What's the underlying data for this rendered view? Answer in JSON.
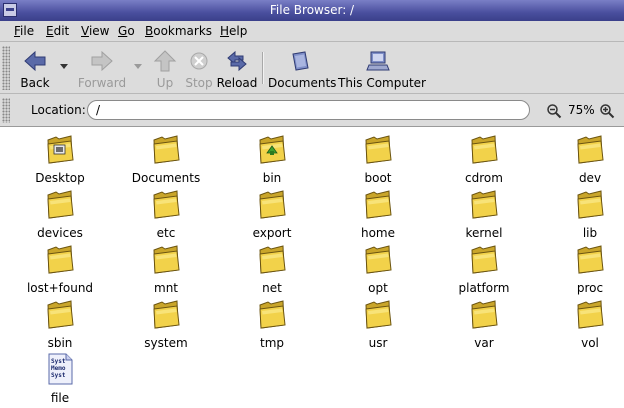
{
  "window": {
    "title": "File Browser: /"
  },
  "menubar": {
    "items": [
      "File",
      "Edit",
      "View",
      "Go",
      "Bookmarks",
      "Help"
    ]
  },
  "toolbar": {
    "buttons": [
      {
        "label": "Back",
        "icon": "back-arrow-icon",
        "enabled": true
      },
      {
        "label": "Forward",
        "icon": "forward-arrow-icon",
        "enabled": false
      },
      {
        "label": "Up",
        "icon": "up-arrow-icon",
        "enabled": false
      },
      {
        "label": "Stop",
        "icon": "stop-icon",
        "enabled": false
      },
      {
        "label": "Reload",
        "icon": "reload-icon",
        "enabled": true
      },
      {
        "label": "Documents",
        "icon": "documents-icon",
        "enabled": true
      },
      {
        "label": "This Computer",
        "icon": "computer-icon",
        "enabled": true
      }
    ]
  },
  "location": {
    "label": "Location:",
    "value": "/"
  },
  "zoom": {
    "level": "75%"
  },
  "colors": {
    "titlebar": "#4a4f9e",
    "folder": "#f2d24a",
    "chrome": "#dcdcdc",
    "icon_blue": "#5a6aa8"
  },
  "files": [
    {
      "name": "Desktop",
      "icon": "desktop-folder-icon"
    },
    {
      "name": "Documents",
      "icon": "folder-icon"
    },
    {
      "name": "bin",
      "icon": "bin-folder-icon"
    },
    {
      "name": "boot",
      "icon": "folder-icon"
    },
    {
      "name": "cdrom",
      "icon": "folder-icon"
    },
    {
      "name": "dev",
      "icon": "folder-icon"
    },
    {
      "name": "devices",
      "icon": "folder-icon"
    },
    {
      "name": "etc",
      "icon": "folder-icon"
    },
    {
      "name": "export",
      "icon": "folder-icon"
    },
    {
      "name": "home",
      "icon": "folder-icon"
    },
    {
      "name": "kernel",
      "icon": "folder-icon"
    },
    {
      "name": "lib",
      "icon": "folder-icon"
    },
    {
      "name": "lost+found",
      "icon": "folder-icon"
    },
    {
      "name": "mnt",
      "icon": "folder-icon"
    },
    {
      "name": "net",
      "icon": "folder-icon"
    },
    {
      "name": "opt",
      "icon": "folder-icon"
    },
    {
      "name": "platform",
      "icon": "folder-icon"
    },
    {
      "name": "proc",
      "icon": "folder-icon"
    },
    {
      "name": "sbin",
      "icon": "folder-icon"
    },
    {
      "name": "system",
      "icon": "folder-icon"
    },
    {
      "name": "tmp",
      "icon": "folder-icon"
    },
    {
      "name": "usr",
      "icon": "folder-icon"
    },
    {
      "name": "var",
      "icon": "folder-icon"
    },
    {
      "name": "vol",
      "icon": "folder-icon"
    },
    {
      "name": "file",
      "icon": "text-file-icon",
      "preview": [
        "Syst",
        "Memo",
        "Syst"
      ]
    }
  ]
}
